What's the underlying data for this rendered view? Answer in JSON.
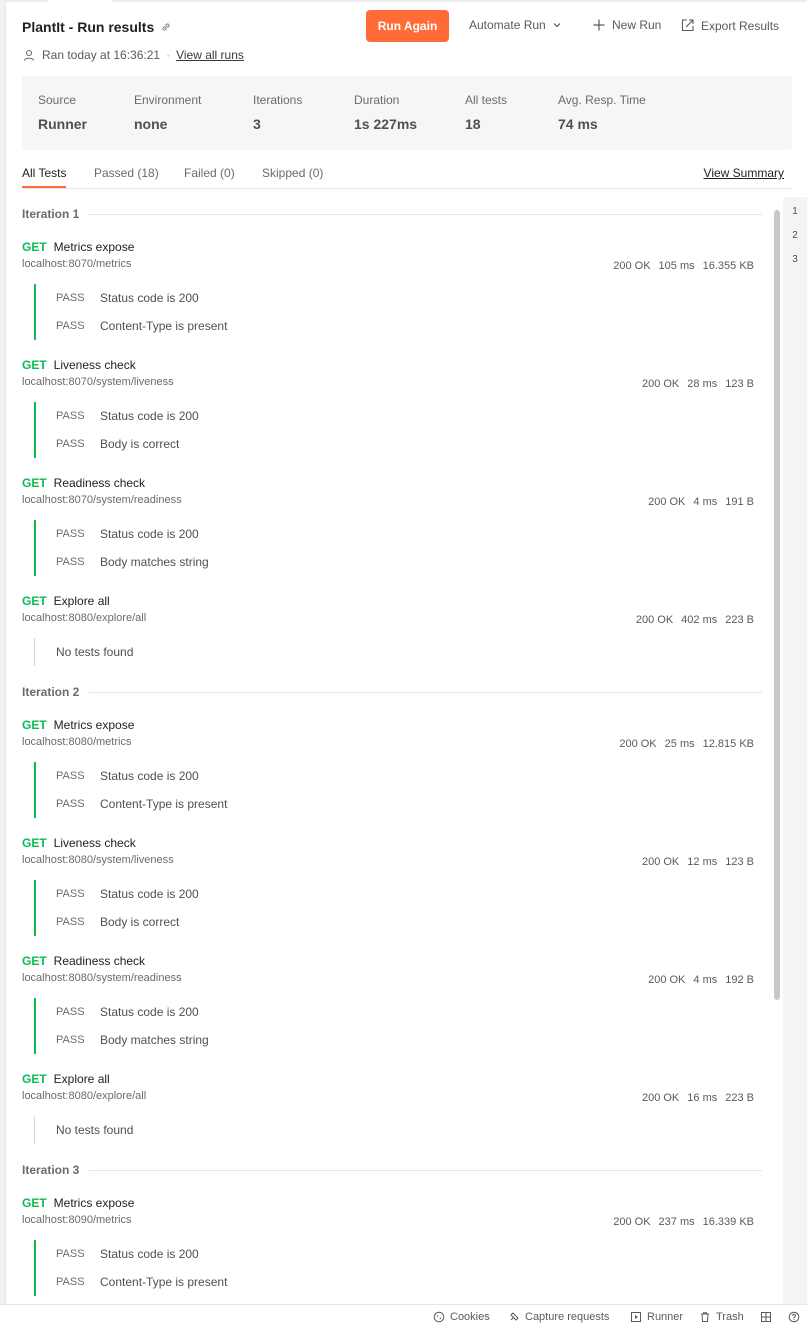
{
  "header": {
    "title": "PlantIt - Run results",
    "run_again": "Run Again",
    "automate_run": "Automate Run",
    "new_run": "New Run",
    "export_results": "Export Results",
    "ran_text": "Ran today at 16:36:21",
    "separator": "·",
    "view_all_runs": "View all runs"
  },
  "stats": [
    {
      "label": "Source",
      "value": "Runner"
    },
    {
      "label": "Environment",
      "value": "none"
    },
    {
      "label": "Iterations",
      "value": "3"
    },
    {
      "label": "Duration",
      "value": "1s 227ms"
    },
    {
      "label": "All tests",
      "value": "18"
    },
    {
      "label": "Avg. Resp. Time",
      "value": "74 ms"
    }
  ],
  "tabs": [
    {
      "label": "All Tests",
      "active": true
    },
    {
      "label": "Passed (18)",
      "active": false
    },
    {
      "label": "Failed (0)",
      "active": false
    },
    {
      "label": "Skipped (0)",
      "active": false
    }
  ],
  "view_summary": "View Summary",
  "iterations": [
    {
      "label": "Iteration 1",
      "requests": [
        {
          "method": "GET",
          "name": "Metrics expose",
          "url": "localhost:8070/metrics",
          "status": "200 OK",
          "time": "105 ms",
          "size": "16.355 KB",
          "tests": [
            {
              "status": "PASS",
              "name": "Status code is 200"
            },
            {
              "status": "PASS",
              "name": "Content-Type is present"
            }
          ]
        },
        {
          "method": "GET",
          "name": "Liveness check",
          "url": "localhost:8070/system/liveness",
          "status": "200 OK",
          "time": "28 ms",
          "size": "123 B",
          "tests": [
            {
              "status": "PASS",
              "name": "Status code is 200"
            },
            {
              "status": "PASS",
              "name": "Body is correct"
            }
          ]
        },
        {
          "method": "GET",
          "name": "Readiness check",
          "url": "localhost:8070/system/readiness",
          "status": "200 OK",
          "time": "4 ms",
          "size": "191 B",
          "tests": [
            {
              "status": "PASS",
              "name": "Status code is 200"
            },
            {
              "status": "PASS",
              "name": "Body matches string"
            }
          ]
        },
        {
          "method": "GET",
          "name": "Explore all",
          "url": "localhost:8080/explore/all",
          "status": "200 OK",
          "time": "402 ms",
          "size": "223 B",
          "tests": [],
          "no_tests": "No tests found"
        }
      ]
    },
    {
      "label": "Iteration 2",
      "requests": [
        {
          "method": "GET",
          "name": "Metrics expose",
          "url": "localhost:8080/metrics",
          "status": "200 OK",
          "time": "25 ms",
          "size": "12.815 KB",
          "tests": [
            {
              "status": "PASS",
              "name": "Status code is 200"
            },
            {
              "status": "PASS",
              "name": "Content-Type is present"
            }
          ]
        },
        {
          "method": "GET",
          "name": "Liveness check",
          "url": "localhost:8080/system/liveness",
          "status": "200 OK",
          "time": "12 ms",
          "size": "123 B",
          "tests": [
            {
              "status": "PASS",
              "name": "Status code is 200"
            },
            {
              "status": "PASS",
              "name": "Body is correct"
            }
          ]
        },
        {
          "method": "GET",
          "name": "Readiness check",
          "url": "localhost:8080/system/readiness",
          "status": "200 OK",
          "time": "4 ms",
          "size": "192 B",
          "tests": [
            {
              "status": "PASS",
              "name": "Status code is 200"
            },
            {
              "status": "PASS",
              "name": "Body matches string"
            }
          ]
        },
        {
          "method": "GET",
          "name": "Explore all",
          "url": "localhost:8080/explore/all",
          "status": "200 OK",
          "time": "16 ms",
          "size": "223 B",
          "tests": [],
          "no_tests": "No tests found"
        }
      ]
    },
    {
      "label": "Iteration 3",
      "requests": [
        {
          "method": "GET",
          "name": "Metrics expose",
          "url": "localhost:8090/metrics",
          "status": "200 OK",
          "time": "237 ms",
          "size": "16.339 KB",
          "tests": [
            {
              "status": "PASS",
              "name": "Status code is 200"
            },
            {
              "status": "PASS",
              "name": "Content-Type is present"
            }
          ]
        }
      ]
    }
  ],
  "iteration_rail": [
    "1",
    "2",
    "3"
  ],
  "statusbar": {
    "cookies": "Cookies",
    "capture": "Capture requests",
    "runner": "Runner",
    "trash": "Trash"
  },
  "colors": {
    "accent": "#ff6c37",
    "pass": "#0cbb52"
  }
}
